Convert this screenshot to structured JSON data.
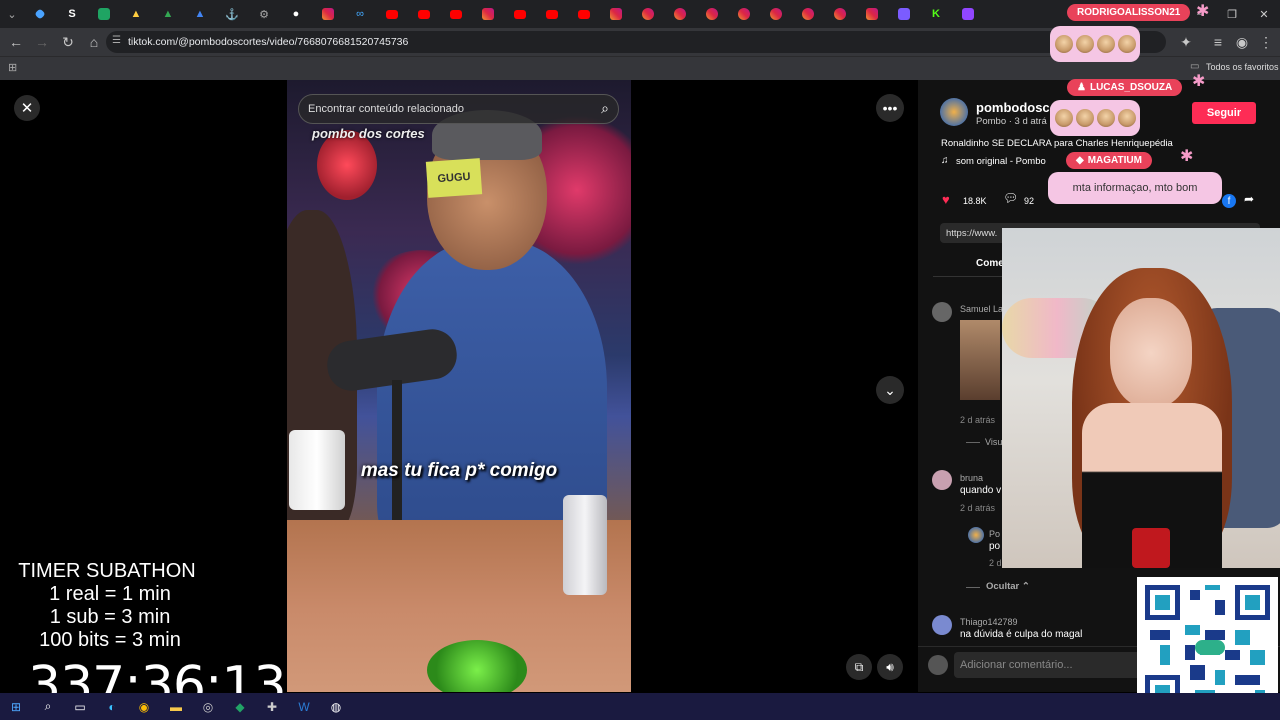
{
  "browser": {
    "url": "tiktok.com/@pombodoscortes/video/7668076681520745736",
    "bookmarks_label": "Todos os favoritos",
    "tab_letter": "S"
  },
  "video": {
    "search_placeholder": "Encontrar conteúdo relacionado",
    "watermark": "pombo dos cortes",
    "subtitle": "mas tu fica p* comigo",
    "sticky_note": "GUGU"
  },
  "author": {
    "name": "pombodosco",
    "subline": "Pombo · 3 d atrá",
    "follow_label": "Seguir",
    "description": "Ronaldinho SE DECLARA para Charles Henriquepédia",
    "sound": "som original - Pombo"
  },
  "stats": {
    "likes": "18.8K",
    "comments": "92"
  },
  "link_prefix": "https://www.",
  "tab_comments": "Come",
  "comments": [
    {
      "name": "Samuel La",
      "time": "2 d atrás",
      "replies_label": "Visu"
    },
    {
      "name": "bruna",
      "text": "quando v",
      "time": "2 d atrás"
    },
    {
      "name": "Po",
      "text": "po",
      "time": "2 d"
    },
    {
      "name": "Thiago142789",
      "text": "na dúvida é culpa do magal"
    }
  ],
  "hide_label": "Ocultar",
  "add_comment_placeholder": "Adicionar comentário...",
  "overlay": {
    "user1": "RODRIGOALISSON21",
    "user2": "LUCAS_DSOUZA",
    "user3": "MAGATIUM",
    "message3": "mta informaçao, mto bom"
  },
  "timer": {
    "title": "TIMER SUBATHON",
    "rule1": "1 real = 1 min",
    "rule2": "1 sub = 3 min",
    "rule3": "100 bits = 3 min",
    "time": "337:36:13"
  },
  "colors": {
    "accent_red": "#fe2c55",
    "tiktok_panel": "#121212",
    "chat_pink": "#f5c6e4",
    "chat_badge": "#e9425a"
  }
}
